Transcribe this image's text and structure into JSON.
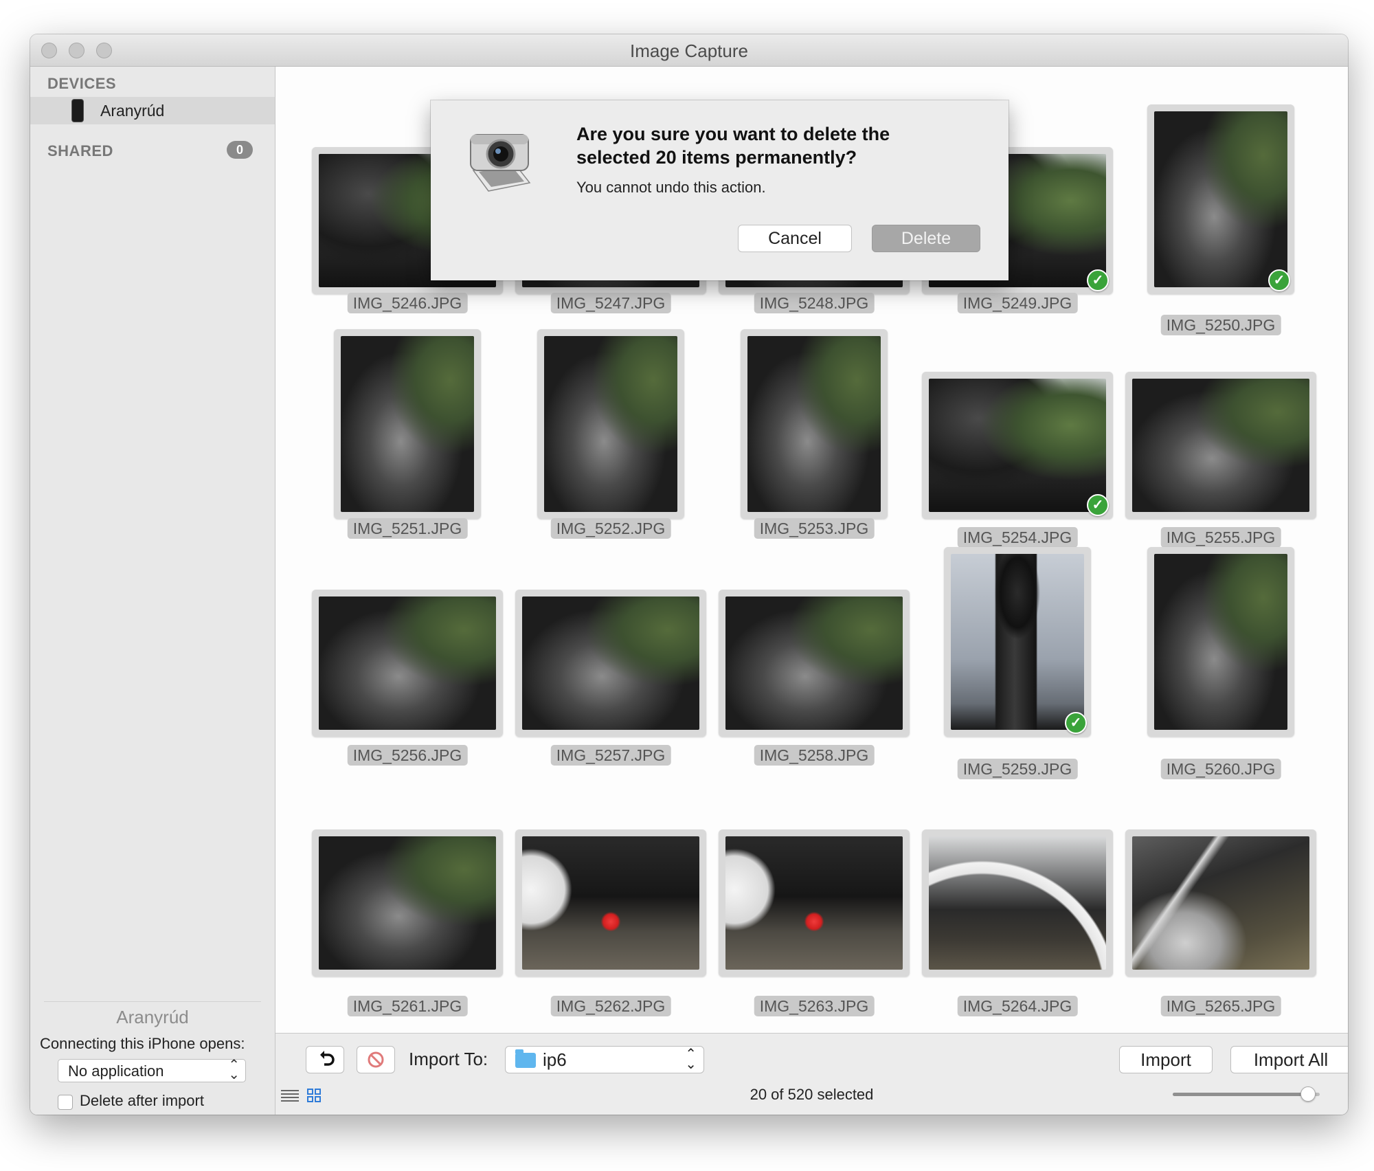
{
  "window": {
    "title": "Image Capture"
  },
  "sidebar": {
    "devices_heading": "DEVICES",
    "device_name": "Aranyrúd",
    "shared_heading": "SHARED",
    "shared_count": "0",
    "selected_device_title": "Aranyrúd",
    "connecting_label": "Connecting this iPhone opens:",
    "open_app_value": "No application",
    "delete_after_import_label": "Delete after import",
    "delete_after_import_checked": false
  },
  "grid": {
    "thumbnails": [
      {
        "file": "IMG_5246.JPG",
        "checked": false,
        "photo": "cylinder"
      },
      {
        "file": "IMG_5247.JPG",
        "checked": false,
        "photo": "locomotive"
      },
      {
        "file": "IMG_5248.JPG",
        "checked": false,
        "photo": "locomotive"
      },
      {
        "file": "IMG_5249.JPG",
        "checked": true,
        "photo": "cylinder"
      },
      {
        "file": "IMG_5250.JPG",
        "checked": true,
        "photo": "locomotive"
      },
      {
        "file": "IMG_5251.JPG",
        "checked": false,
        "photo": "locomotive"
      },
      {
        "file": "IMG_5252.JPG",
        "checked": false,
        "photo": "locomotive"
      },
      {
        "file": "IMG_5253.JPG",
        "checked": false,
        "photo": "locomotive"
      },
      {
        "file": "IMG_5254.JPG",
        "checked": true,
        "photo": "cylinder"
      },
      {
        "file": "IMG_5255.JPG",
        "checked": false,
        "photo": "locomotive"
      },
      {
        "file": "IMG_5256.JPG",
        "checked": false,
        "photo": "locomotive"
      },
      {
        "file": "IMG_5257.JPG",
        "checked": false,
        "photo": "locomotive"
      },
      {
        "file": "IMG_5258.JPG",
        "checked": false,
        "photo": "locomotive"
      },
      {
        "file": "IMG_5259.JPG",
        "checked": true,
        "photo": "smokestack"
      },
      {
        "file": "IMG_5260.JPG",
        "checked": false,
        "photo": "locomotive"
      },
      {
        "file": "IMG_5261.JPG",
        "checked": false,
        "photo": "locomotive"
      },
      {
        "file": "IMG_5262.JPG",
        "checked": false,
        "photo": "red-marker"
      },
      {
        "file": "IMG_5263.JPG",
        "checked": false,
        "photo": "red-marker"
      },
      {
        "file": "IMG_5264.JPG",
        "checked": false,
        "photo": "wheel"
      },
      {
        "file": "IMG_5265.JPG",
        "checked": false,
        "photo": "spokes"
      }
    ]
  },
  "toolbar": {
    "import_to_label": "Import To:",
    "import_to_value": "ip6",
    "import_button": "Import",
    "import_all_button": "Import All",
    "status": "20 of 520 selected",
    "thumbnail_size_fraction": 0.92
  },
  "dialog": {
    "title": "Are you sure you want to delete the selected 20 items permanently?",
    "message": "You cannot undo this action.",
    "cancel_button": "Cancel",
    "delete_button": "Delete"
  },
  "icons": {
    "rotate": "rotate-icon",
    "delete": "delete-icon",
    "folder": "folder-icon",
    "list_view": "list-view-icon",
    "grid_view": "grid-view-icon",
    "device": "iphone-icon",
    "dialog_app": "image-capture-app-icon"
  },
  "colors": {
    "check_green": "#3aa33a",
    "folder_blue": "#5fb6ee"
  }
}
